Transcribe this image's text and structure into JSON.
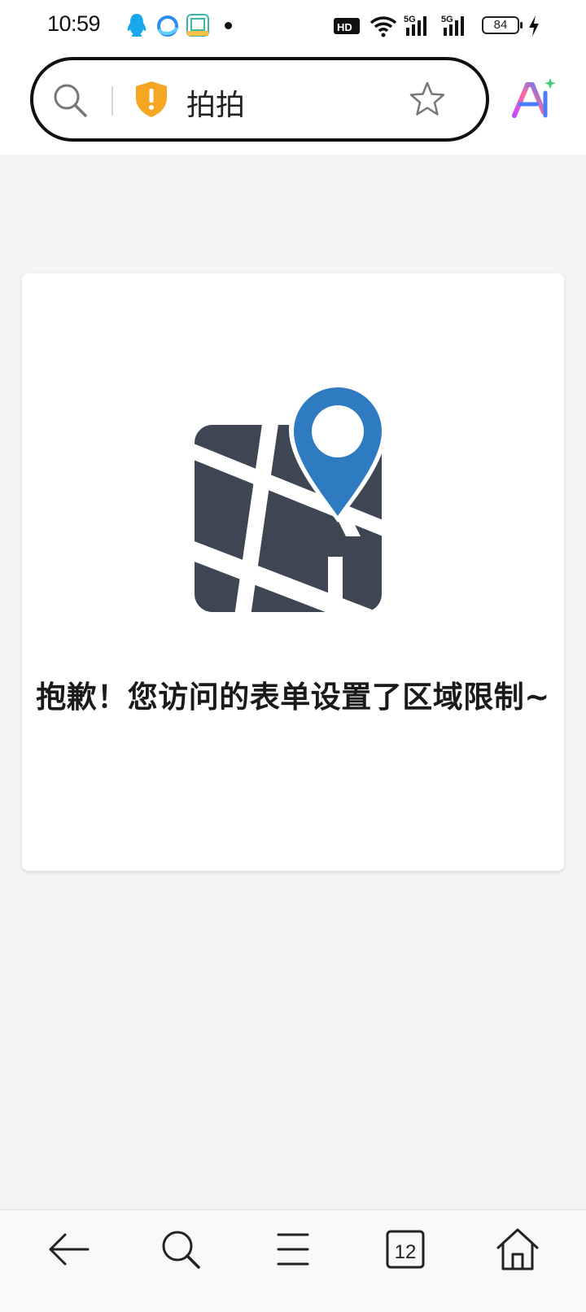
{
  "status_bar": {
    "time": "10:59",
    "battery_level": "84",
    "hd_label": "HD",
    "signal_labels": [
      "5G",
      "5G"
    ],
    "notification_icons": [
      "qq-icon",
      "browser-icon",
      "xianyu-app-icon",
      "dot-indicator"
    ]
  },
  "browser": {
    "site_name": "拍拍",
    "security_status": "warning",
    "colors": {
      "shield": "#f5a623",
      "ai_gradient": [
        "#4a7cff",
        "#c04bff",
        "#ff6aa0"
      ]
    }
  },
  "content": {
    "message": "抱歉！您访问的表单设置了区域限制~",
    "illustration": "map-pin-icon",
    "colors": {
      "map": "#3e4653",
      "pin": "#2f7bc1"
    }
  },
  "bottom_nav": {
    "items": [
      {
        "name": "back",
        "icon": "back-arrow-icon"
      },
      {
        "name": "search",
        "icon": "search-icon"
      },
      {
        "name": "menu",
        "icon": "menu-icon"
      },
      {
        "name": "tabs",
        "icon": "tabs-icon",
        "count": "12"
      },
      {
        "name": "home",
        "icon": "home-icon"
      }
    ]
  }
}
